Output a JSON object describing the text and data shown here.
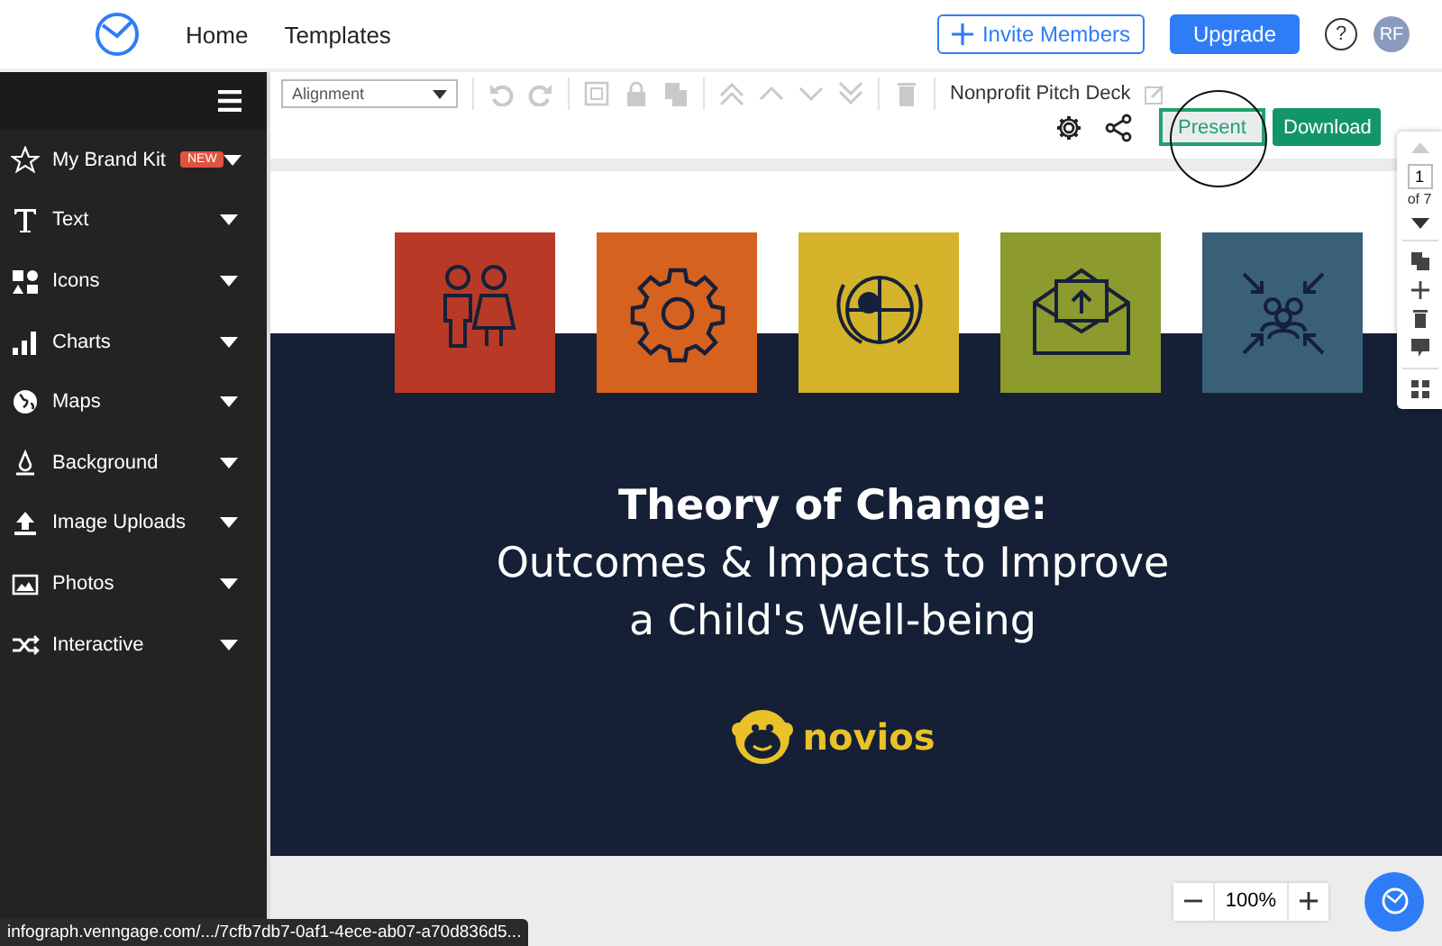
{
  "topbar": {
    "nav": [
      {
        "label": "Home"
      },
      {
        "label": "Templates"
      }
    ],
    "invite_button": "Invite Members",
    "upgrade_button": "Upgrade",
    "help": "?",
    "avatar": "RF"
  },
  "sidebar": {
    "items": [
      {
        "label": "My Brand Kit",
        "badge": "NEW"
      },
      {
        "label": "Text"
      },
      {
        "label": "Icons"
      },
      {
        "label": "Charts"
      },
      {
        "label": "Maps"
      },
      {
        "label": "Background"
      },
      {
        "label": "Image Uploads"
      },
      {
        "label": "Photos"
      },
      {
        "label": "Interactive"
      }
    ]
  },
  "toolbar": {
    "dropdown": "Alignment",
    "document_title": "Nonprofit Pitch Deck",
    "present_button": "Present",
    "download_button": "Download"
  },
  "slide": {
    "tiles": [
      {
        "color": "#b83a26"
      },
      {
        "color": "#d5621f"
      },
      {
        "color": "#d4b32a"
      },
      {
        "color": "#8c9a2e"
      },
      {
        "color": "#3a6078"
      }
    ],
    "title": "Theory of Change:",
    "subtitle_lines": [
      "Outcomes & Impacts to Improve",
      "a Child's Well-being"
    ],
    "logo_text": "novios"
  },
  "page_nav": {
    "page": "1",
    "of": "of 7"
  },
  "zoom": {
    "value": "100%"
  },
  "status_url": "infograph.venngage.com/.../7cfb7db7-0af1-4ece-ab07-a70d836d5..."
}
